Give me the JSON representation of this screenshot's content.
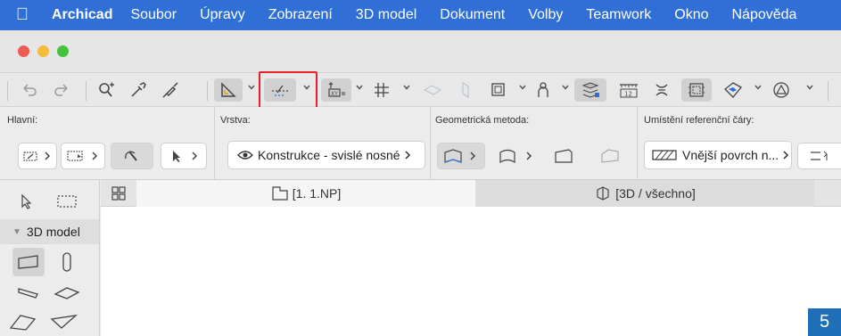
{
  "menubar": {
    "items": [
      "Archicad",
      "Soubor",
      "Úpravy",
      "Zobrazení",
      "3D model",
      "Dokument",
      "Volby",
      "Teamwork",
      "Okno",
      "Nápověda"
    ]
  },
  "infobox": {
    "main_label": "Hlavní:",
    "layer_label": "Vrstva:",
    "geometry_label": "Geometrická metoda:",
    "refline_label": "Umístění referenční čáry:",
    "layer_value": "Konstrukce - svislé nosné",
    "refline_value": "Vnější povrch n..."
  },
  "toolbox": {
    "section_label": "3D model"
  },
  "tabs": [
    {
      "label": "[1. 1.NP]",
      "icon": "floor-plan-icon"
    },
    {
      "label": "[3D / všechno]",
      "icon": "3d-view-icon"
    }
  ],
  "badge": "5",
  "colors": {
    "menubar": "#2f6fd6",
    "highlight": "#e8202a",
    "badge": "#1f6fb8"
  }
}
